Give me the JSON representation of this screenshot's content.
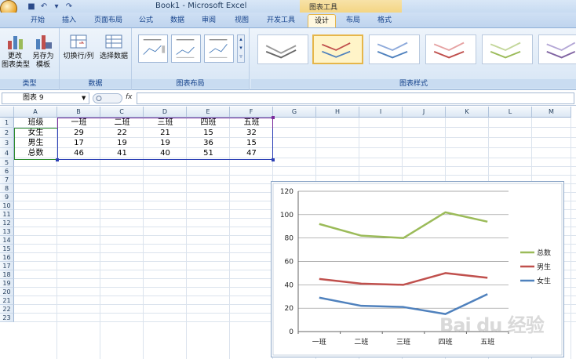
{
  "window": {
    "title": "Book1 - Microsoft Excel",
    "contextual_tools_label": "图表工具"
  },
  "tabs": [
    {
      "label": "开始"
    },
    {
      "label": "插入"
    },
    {
      "label": "页面布局"
    },
    {
      "label": "公式"
    },
    {
      "label": "数据"
    },
    {
      "label": "审阅"
    },
    {
      "label": "视图"
    },
    {
      "label": "开发工具"
    },
    {
      "label": "设计"
    },
    {
      "label": "布局"
    },
    {
      "label": "格式"
    }
  ],
  "ribbon": {
    "type_group": {
      "label": "类型",
      "change_type": "更改\n图表类型",
      "save_template": "另存为\n模板"
    },
    "data_group": {
      "label": "数据",
      "switch_row_col": "切换行/列",
      "select_data": "选择数据"
    },
    "layouts_group": {
      "label": "图表布局"
    },
    "styles_group": {
      "label": "图表样式"
    }
  },
  "formula_bar": {
    "name_box": "图表 9",
    "fx": "fx",
    "formula": ""
  },
  "columns": [
    "A",
    "B",
    "C",
    "D",
    "E",
    "F",
    "G",
    "H",
    "I",
    "J",
    "K",
    "L",
    "M"
  ],
  "rows": [
    "1",
    "2",
    "3",
    "4",
    "5",
    "6",
    "7",
    "8",
    "9",
    "10",
    "11",
    "12",
    "13",
    "14",
    "15",
    "16",
    "17",
    "18",
    "19",
    "20",
    "21",
    "22",
    "23"
  ],
  "table": {
    "header": [
      "班级",
      "一班",
      "二班",
      "三班",
      "四班",
      "五班"
    ],
    "rows": [
      [
        "女生",
        "29",
        "22",
        "21",
        "15",
        "32"
      ],
      [
        "男生",
        "17",
        "19",
        "19",
        "36",
        "15"
      ],
      [
        "总数",
        "46",
        "41",
        "40",
        "51",
        "47"
      ]
    ]
  },
  "chart_data": {
    "type": "line",
    "categories": [
      "一班",
      "二班",
      "三班",
      "四班",
      "五班"
    ],
    "series": [
      {
        "name": "总数",
        "values": [
          92,
          82,
          80,
          102,
          94
        ],
        "color": "#9bbb59"
      },
      {
        "name": "男生",
        "values": [
          45,
          41,
          40,
          50,
          46
        ],
        "color": "#c0504d"
      },
      {
        "name": "女生",
        "values": [
          29,
          22,
          21,
          15,
          32
        ],
        "color": "#4f81bd"
      }
    ],
    "ylim": [
      0,
      120
    ],
    "yticks": [
      "0",
      "20",
      "40",
      "60",
      "80",
      "100",
      "120"
    ],
    "grid": true,
    "legend": "right"
  },
  "watermark": "Bai du 经验"
}
